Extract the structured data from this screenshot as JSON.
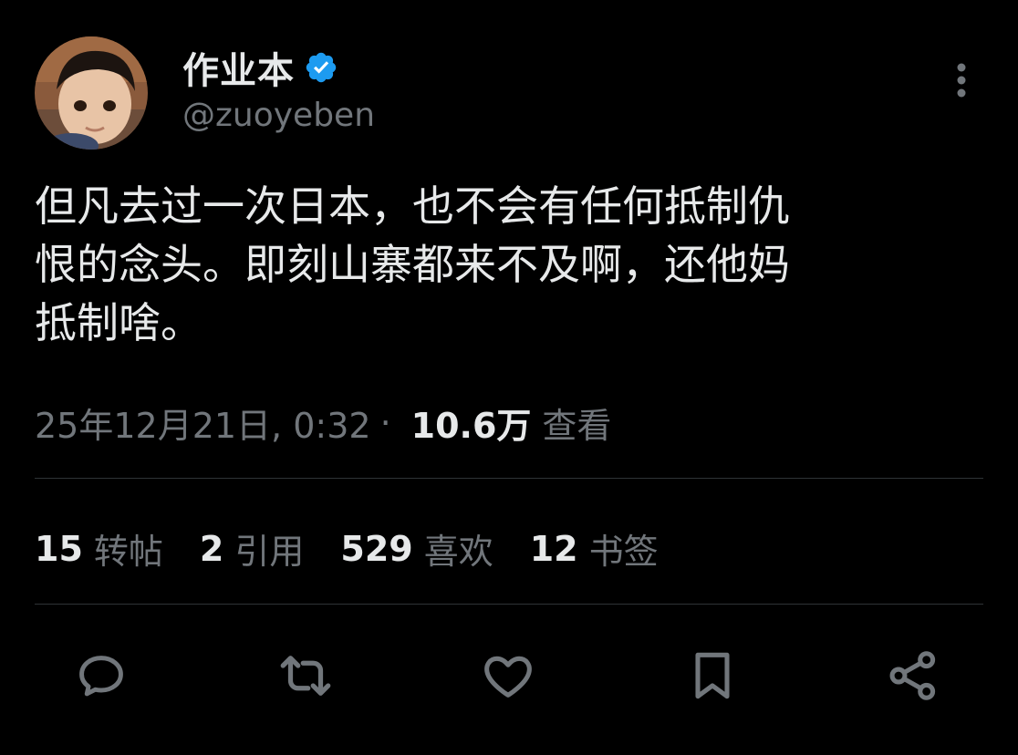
{
  "user": {
    "display_name": "作业本",
    "handle": "@zuoyeben",
    "verified_icon": "verified-badge-icon",
    "avatar_icon": "avatar"
  },
  "tweet": {
    "text": "但凡去过一次日本，也不会有任何抵制仇\n恨的念头。即刻山寨都来不及啊，还他妈\n抵制啥。",
    "timestamp": "25年12月21日, 0:32",
    "separator": "·",
    "views_count": "10.6万",
    "views_label": "查看"
  },
  "stats": [
    {
      "count": "15",
      "label": "转帖"
    },
    {
      "count": "2",
      "label": "引用"
    },
    {
      "count": "529",
      "label": "喜欢"
    },
    {
      "count": "12",
      "label": "书签"
    }
  ],
  "actions": [
    {
      "icon": "reply-icon"
    },
    {
      "icon": "retweet-icon"
    },
    {
      "icon": "like-icon"
    },
    {
      "icon": "bookmark-icon"
    },
    {
      "icon": "share-icon"
    }
  ],
  "colors": {
    "background": "#000000",
    "primary_text": "#e7e9ea",
    "secondary_text": "#71767b",
    "divider": "#2f3336",
    "verified": "#1d9bf0"
  }
}
